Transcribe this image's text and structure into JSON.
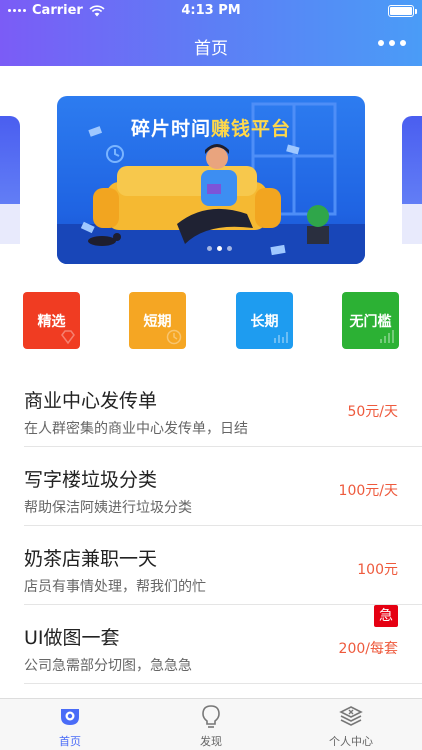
{
  "status_bar": {
    "carrier": "Carrier",
    "time": "4:13 PM"
  },
  "nav": {
    "title": "首页"
  },
  "banner": {
    "title_part1": "碎片时间",
    "title_part2": "赚钱平台",
    "page_count": 3,
    "active_page": 1
  },
  "categories": [
    {
      "label": "精选",
      "color": "#f03c22"
    },
    {
      "label": "短期",
      "color": "#f5a623"
    },
    {
      "label": "长期",
      "color": "#1e9cf0"
    },
    {
      "label": "无门槛",
      "color": "#2cb134"
    }
  ],
  "jobs": [
    {
      "title": "商业中心发传单",
      "desc": "在人群密集的商业中心发传单，日结",
      "price": "50元/天",
      "urgent": ""
    },
    {
      "title": "写字楼垃圾分类",
      "desc": "帮助保洁阿姨进行垃圾分类",
      "price": "100元/天",
      "urgent": ""
    },
    {
      "title": "奶茶店兼职一天",
      "desc": "店员有事情处理，帮我们的忙",
      "price": "100元",
      "urgent": ""
    },
    {
      "title": "UI做图一套",
      "desc": "公司急需部分切图，急急急",
      "price": "200/每套",
      "urgent": "急"
    }
  ],
  "tabbar": {
    "tabs": [
      {
        "label": "首页",
        "icon": "home-camera-icon",
        "active": true
      },
      {
        "label": "发现",
        "icon": "lightbulb-icon",
        "active": false
      },
      {
        "label": "个人中心",
        "icon": "layers-icon",
        "active": false
      }
    ]
  },
  "colors": {
    "header_gradient_start": "#7b5cf6",
    "header_gradient_end": "#4a9cf7",
    "price": "#ee5a3d",
    "urgent": "#e50012",
    "tab_active": "#4a6cf7"
  }
}
